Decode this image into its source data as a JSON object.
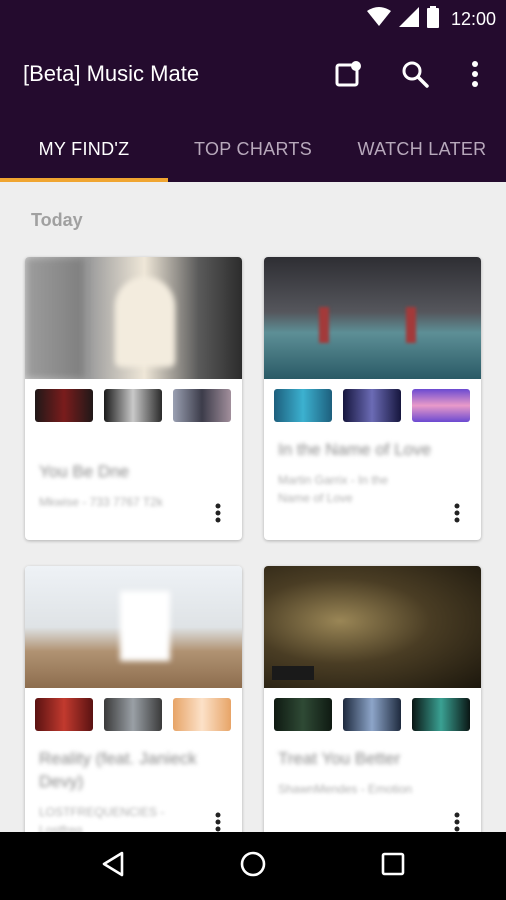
{
  "status_bar": {
    "time": "12:00",
    "icons": [
      "wifi-icon",
      "signal-icon",
      "battery-icon"
    ]
  },
  "app_bar": {
    "title": "[Beta] Music Mate",
    "actions": [
      "notification-icon",
      "search-icon",
      "overflow-menu-icon"
    ]
  },
  "tabs": [
    {
      "label": "MY FIND'Z",
      "active": true
    },
    {
      "label": "TOP CHARTS",
      "active": false
    },
    {
      "label": "WATCH LATER",
      "active": false
    }
  ],
  "section_header": "Today",
  "cards": [
    {
      "title": "You Be Dne",
      "subtitle": "Mkwise - 733 7767 T2k",
      "hero_colors": [
        "#cfcfcf",
        "#3a3a3a"
      ],
      "thumb_colors": [
        [
          "#2a1f1f",
          "#7a1c1c"
        ],
        [
          "#1b1b1b",
          "#bdbdbd"
        ],
        [
          "#8e8ea0",
          "#3c3c4a"
        ]
      ]
    },
    {
      "title": "In the Name of Love",
      "subtitle": "Martin Garrix - In the Name of Love",
      "hero_colors": [
        "#3d3f44",
        "#4d8a93"
      ],
      "thumb_colors": [
        [
          "#3cb1d0",
          "#1d5f7d"
        ],
        [
          "#16163e",
          "#6b6bb5"
        ],
        [
          "#6b4ad1",
          "#e99ac9"
        ]
      ]
    },
    {
      "title": "Reality (feat. Janieck Devy)",
      "subtitle": "LOSTFREQUENCIES - Lostfreq",
      "hero_colors": [
        "#e9eef4",
        "#a88561"
      ],
      "thumb_colors": [
        [
          "#5a1212",
          "#c23a2e"
        ],
        [
          "#3a3a3a",
          "#9aa0a6"
        ],
        [
          "#e7a467",
          "#fce1c8"
        ]
      ]
    },
    {
      "title": "Treat You Better",
      "subtitle": "ShawnMendes - Emotion",
      "hero_colors": [
        "#2b2416",
        "#8d7a4a"
      ],
      "thumb_colors": [
        [
          "#0f1a12",
          "#2f4a35"
        ],
        [
          "#1e2a3e",
          "#8da5c9"
        ],
        [
          "#0a1614",
          "#3aa193"
        ]
      ]
    }
  ],
  "nav_bar": {
    "buttons": [
      "back-icon",
      "home-icon",
      "recents-icon"
    ]
  }
}
